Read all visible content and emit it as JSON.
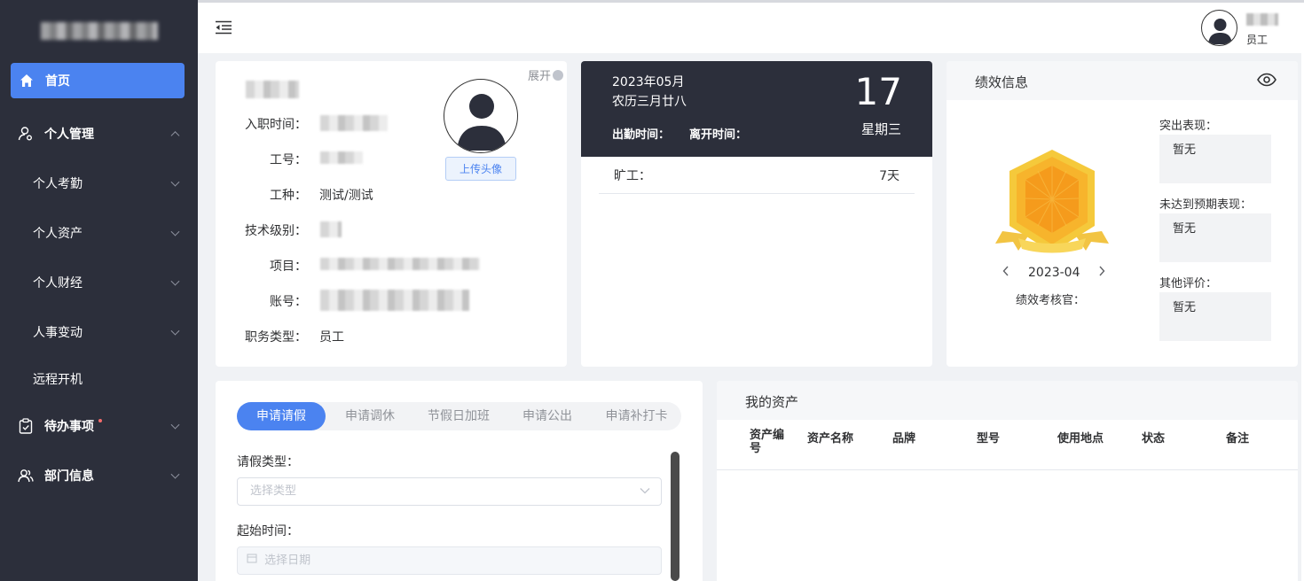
{
  "sidebar": {
    "items": [
      {
        "label": "首页"
      },
      {
        "label": "个人管理"
      },
      {
        "label": "个人考勤"
      },
      {
        "label": "个人资产"
      },
      {
        "label": "个人财经"
      },
      {
        "label": "人事变动"
      },
      {
        "label": "远程开机"
      },
      {
        "label": "待办事项"
      },
      {
        "label": "部门信息"
      }
    ]
  },
  "header": {
    "user_role": "员工"
  },
  "profile": {
    "expand_label": "展开",
    "fields": {
      "hire_date_label": "入职时间：",
      "employee_no_label": "工号：",
      "job_type_label": "工种：",
      "job_type_value": "测试/测试",
      "tech_level_label": "技术级别：",
      "project_label": "项目：",
      "account_label": "账号：",
      "position_type_label": "职务类型：",
      "position_type_value": "员工"
    },
    "upload_label": "上传头像"
  },
  "attendance": {
    "year_month": "2023年05月",
    "lunar": "农历三月廿八",
    "day": "17",
    "weekday": "星期三",
    "checkin_label": "出勤时间：",
    "checkout_label": "离开时间：",
    "absence_label": "旷工：",
    "absence_value": "7天"
  },
  "performance": {
    "title": "绩效信息",
    "period": "2023-04",
    "reviewer_label": "绩效考核官：",
    "outstanding_label": "突出表现：",
    "outstanding_value": "暂无",
    "below_label": "未达到预期表现：",
    "below_value": "暂无",
    "other_label": "其他评价：",
    "other_value": "暂无"
  },
  "apply": {
    "tabs": [
      "申请请假",
      "申请调休",
      "节假日加班",
      "申请公出",
      "申请补打卡"
    ],
    "leave_type_label": "请假类型：",
    "leave_type_placeholder": "选择类型",
    "start_label": "起始时间：",
    "start_placeholder": "选择日期"
  },
  "assets": {
    "title": "我的资产",
    "columns": [
      "资产编号",
      "资产名称",
      "品牌",
      "型号",
      "使用地点",
      "状态",
      "备注"
    ]
  },
  "colors": {
    "accent": "#4b83f0",
    "sidebar_bg": "#2c2f3b",
    "badge_red": "#f56c6c",
    "medal_gold": "#f7b42c"
  }
}
